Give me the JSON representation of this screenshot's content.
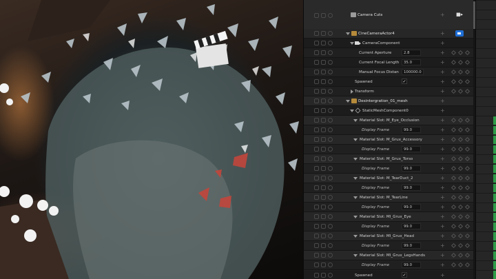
{
  "sequencer": {
    "camera_cuts": {
      "label": "Camera Cuts",
      "icon": "camera-cuts-icon"
    },
    "camera_actor": {
      "label": "CineCameraActor4",
      "component": "CameraComponent",
      "properties": [
        {
          "label": "Current Aperture",
          "value": "2.8"
        },
        {
          "label": "Current Focal Length",
          "value": "35.0"
        },
        {
          "label": "Manual Focus Distan",
          "value": "100000.0"
        }
      ],
      "spawned_label": "Spawned",
      "transform_label": "Transform"
    },
    "mesh_actor": {
      "label": "Desintergration_01_mesh",
      "component": "StaticMeshComponent0",
      "slots": [
        {
          "label": "Material Slot: M_Eye_Occlusion",
          "param": "Display Frame",
          "value": "99.0"
        },
        {
          "label": "Material Slot: M_Grux_Accessory",
          "param": "Display Frame",
          "value": "99.0"
        },
        {
          "label": "Material Slot: M_Grux_Torso",
          "param": "Display Frame",
          "value": "99.0"
        },
        {
          "label": "Material Slot: M_TearDuct_2",
          "param": "Display Frame",
          "value": "99.0"
        },
        {
          "label": "Material Slot: M_TearLine",
          "param": "Display Frame",
          "value": "99.0"
        },
        {
          "label": "Material Slot: MI_Grux_Eye",
          "param": "Display Frame",
          "value": "99.0"
        },
        {
          "label": "Material Slot: MI_Grux_Head",
          "param": "Display Frame",
          "value": "99.0"
        },
        {
          "label": "Material Slot: MI_Grux_LegsHands",
          "param": "Display Frame",
          "value": "99.0"
        }
      ],
      "spawned_label": "Spawned"
    },
    "check_mark": "✓",
    "add_glyph": "+"
  },
  "colors": {
    "accent_blue": "#1f6fd6",
    "keyframe_green": "#2f9a48",
    "panel_bg": "#202020"
  }
}
